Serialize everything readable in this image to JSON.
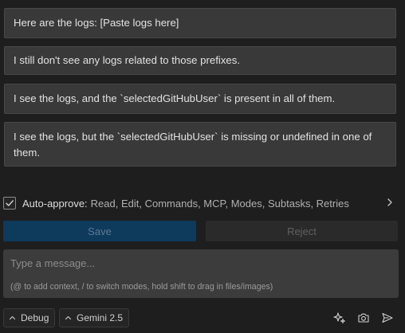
{
  "suggestions": [
    {
      "text": "Here are the logs: [Paste logs here]"
    },
    {
      "text": "I still don't see any logs related to those prefixes."
    },
    {
      "text": "I see the logs, and the `selectedGitHubUser` is present in all of them."
    },
    {
      "text": "I see the logs, but the `selectedGitHubUser` is missing or undefined in one of them."
    }
  ],
  "auto_approve": {
    "checked": true,
    "label": "Auto-approve:",
    "items": "Read, Edit, Commands, MCP, Modes, Subtasks, Retries",
    "expand_icon": "chevron-right-icon"
  },
  "actions": {
    "save_label": "Save",
    "reject_label": "Reject"
  },
  "composer": {
    "placeholder": "Type a message...",
    "hint": "(@ to add context, / to switch modes, hold shift to drag in files/images)"
  },
  "footer": {
    "mode_label": "Debug",
    "model_label": "Gemini 2.5",
    "icons": [
      "sparkle-icon",
      "camera-icon",
      "send-icon"
    ]
  },
  "colors": {
    "background": "#1e1e1e",
    "suggestion_bg": "#393939",
    "save_bg": "#0e3a5c",
    "composer_bg": "#3c3c3c"
  }
}
